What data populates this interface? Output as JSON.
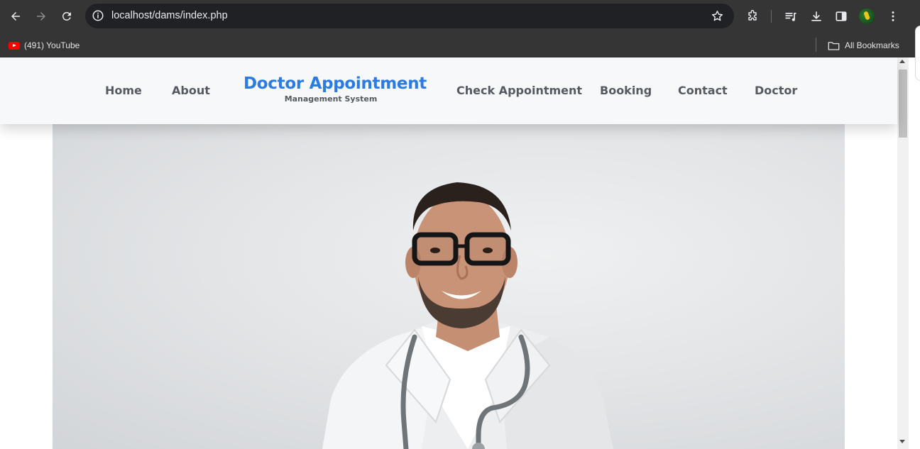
{
  "browser": {
    "url_host": "localhost",
    "url_path": "/dams/index.php",
    "bookmarks": [
      {
        "label": "(491) YouTube",
        "icon": "youtube-icon"
      }
    ],
    "all_bookmarks_label": "All Bookmarks"
  },
  "site": {
    "brand_title": "Doctor Appointment",
    "brand_subtitle": "Management System",
    "nav_left": [
      "Home",
      "About"
    ],
    "nav_right": [
      "Check Appointment",
      "Booking",
      "Contact",
      "Doctor"
    ],
    "brand_color": "#2a7be4",
    "nav_color": "#555a60"
  },
  "hero": {
    "image": "doctor-portrait"
  }
}
